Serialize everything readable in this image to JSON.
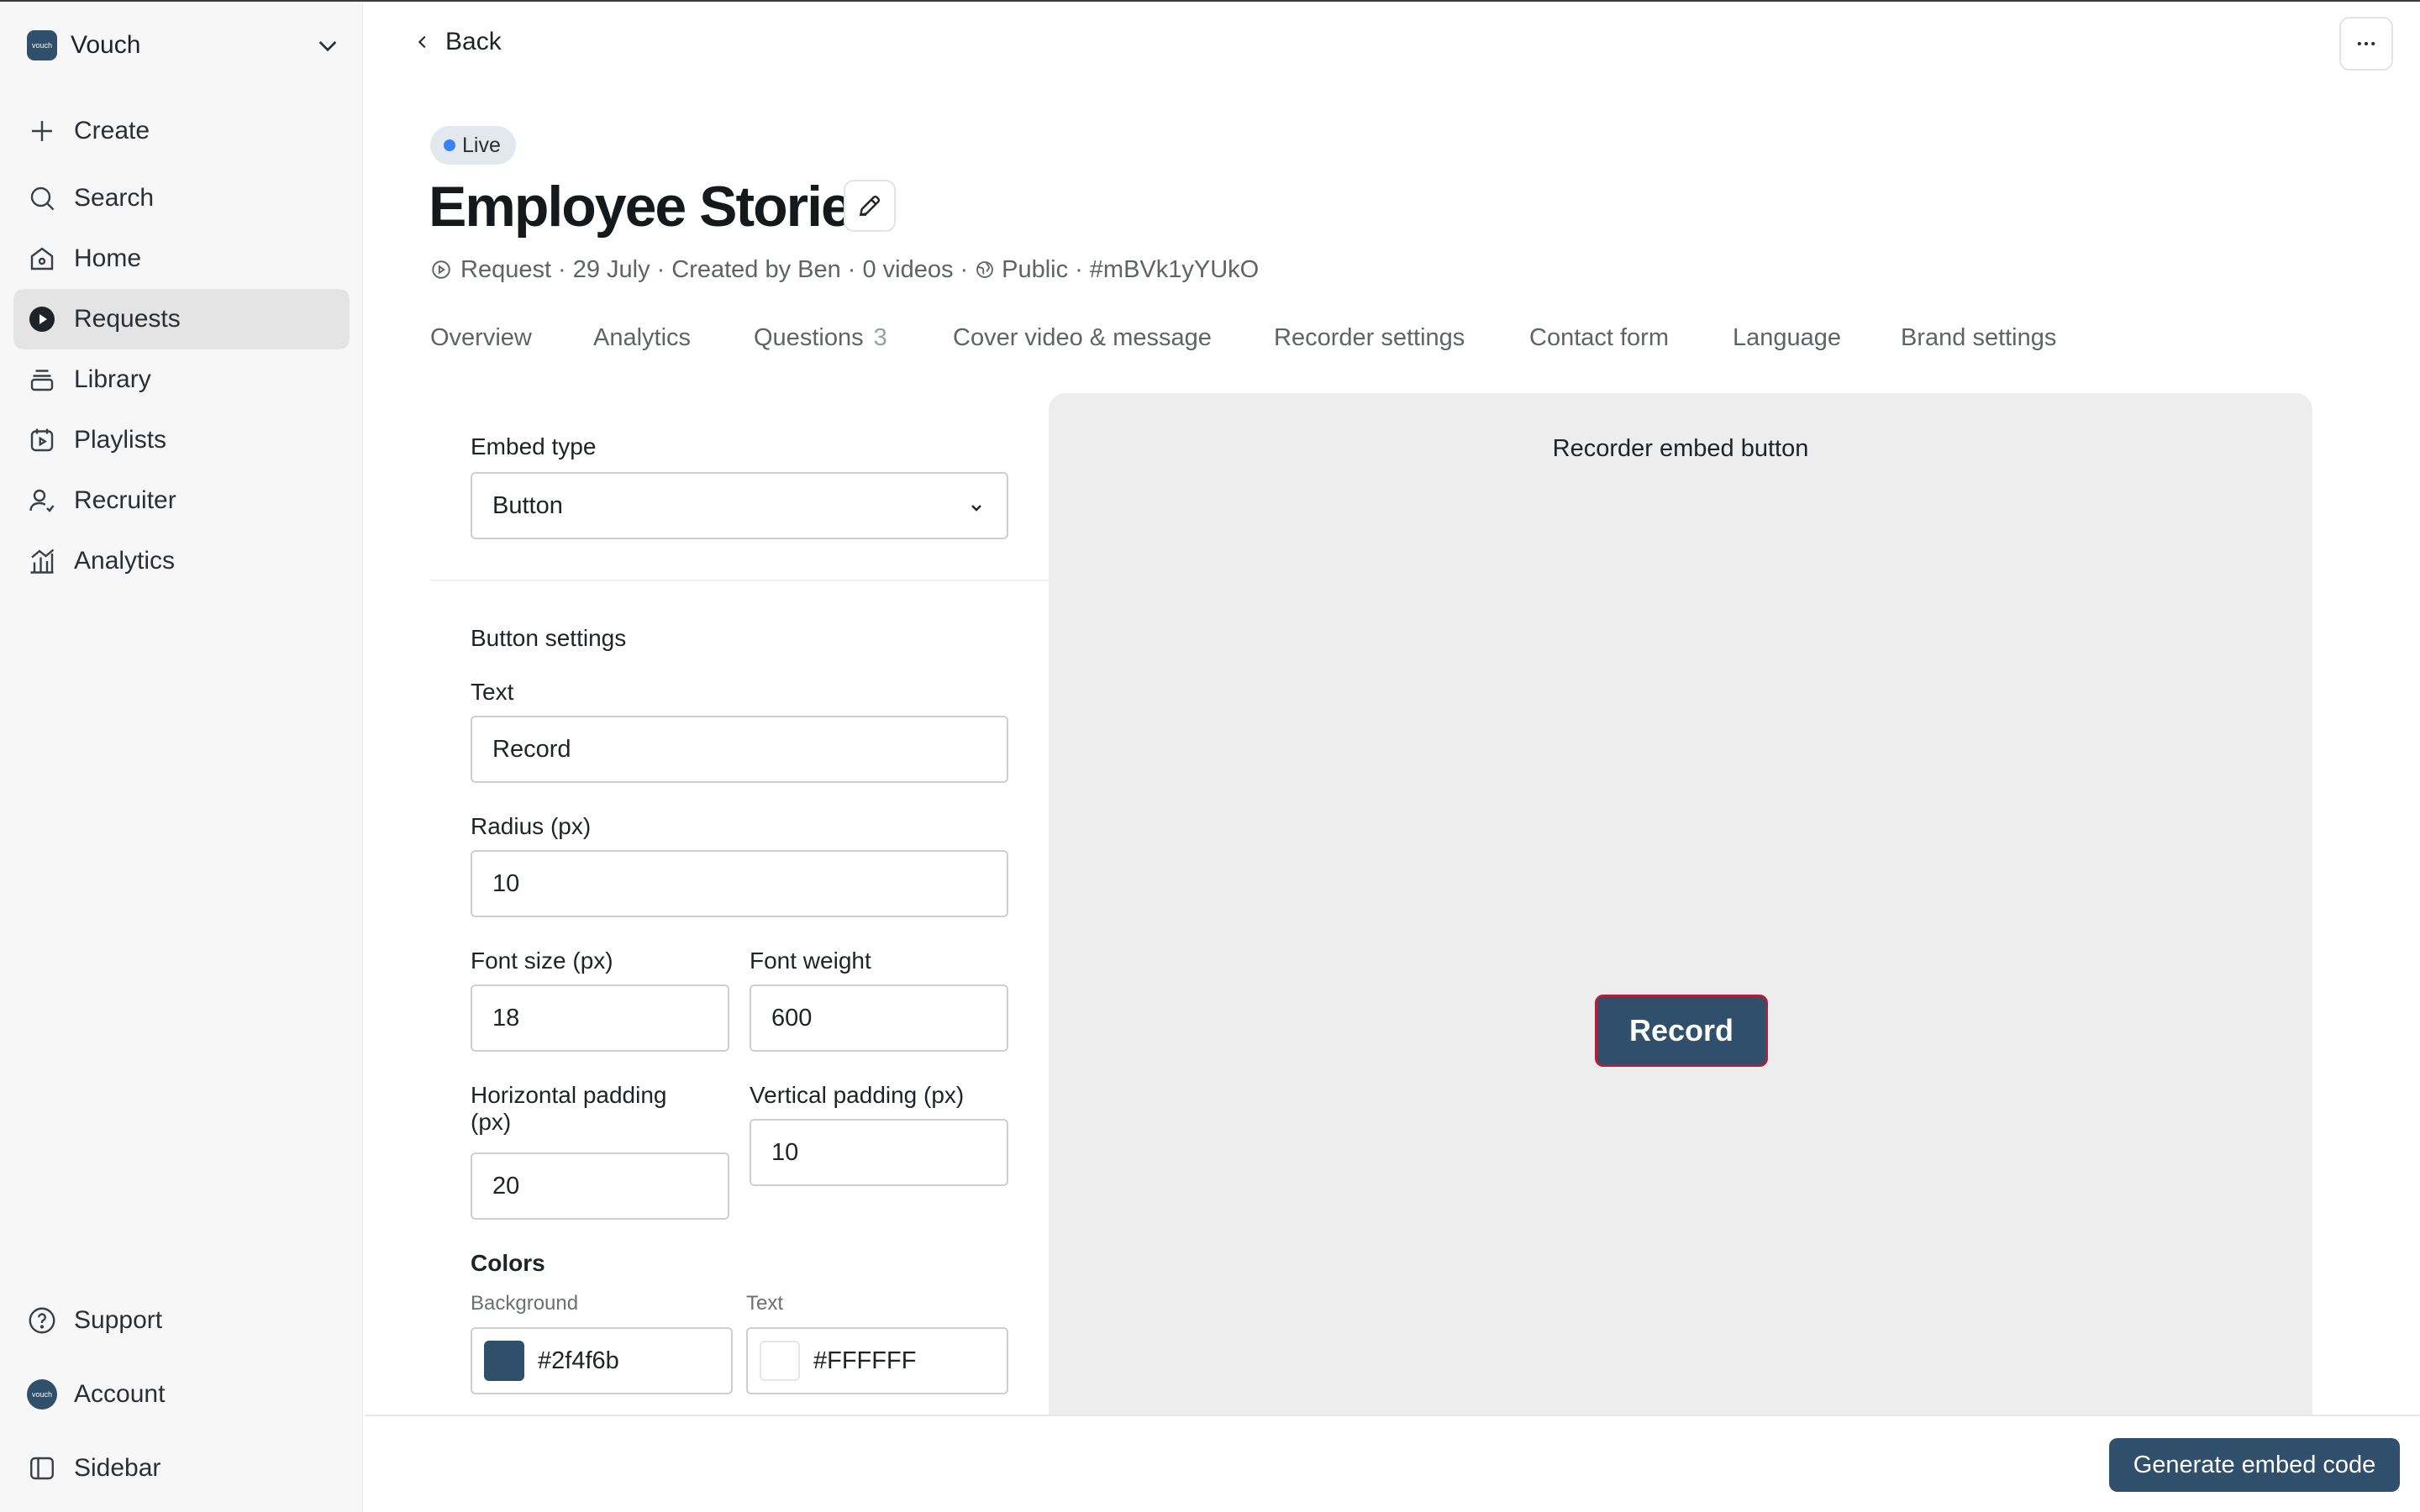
{
  "workspace": {
    "name": "Vouch",
    "logo_text": "vouch"
  },
  "sidebar": {
    "items": [
      {
        "label": "Create",
        "icon": "plus-icon"
      },
      {
        "label": "Search",
        "icon": "search-icon"
      },
      {
        "label": "Home",
        "icon": "home-icon"
      },
      {
        "label": "Requests",
        "icon": "requests-icon",
        "active": true
      },
      {
        "label": "Library",
        "icon": "library-icon"
      },
      {
        "label": "Playlists",
        "icon": "playlists-icon"
      },
      {
        "label": "Recruiter",
        "icon": "recruiter-icon"
      },
      {
        "label": "Analytics",
        "icon": "analytics-icon"
      }
    ],
    "bottom": [
      {
        "label": "Support",
        "icon": "help-icon"
      },
      {
        "label": "Account",
        "icon": "account-avatar"
      },
      {
        "label": "Sidebar",
        "icon": "sidebar-toggle-icon"
      }
    ]
  },
  "header": {
    "back_label": "Back",
    "status": "Live",
    "title": "Employee Stories",
    "meta": {
      "type": "Request",
      "date": "29 July",
      "created_by": "Created by Ben",
      "videos": "0 videos",
      "visibility": "Public",
      "id": "#mBVk1yYUkO"
    }
  },
  "tabs": [
    {
      "label": "Overview"
    },
    {
      "label": "Analytics"
    },
    {
      "label": "Questions",
      "count": "3"
    },
    {
      "label": "Cover video & message"
    },
    {
      "label": "Recorder settings"
    },
    {
      "label": "Contact form"
    },
    {
      "label": "Language"
    },
    {
      "label": "Brand settings"
    }
  ],
  "settings": {
    "embed_type_label": "Embed type",
    "embed_type_value": "Button",
    "button_settings_label": "Button settings",
    "text_label": "Text",
    "text_value": "Record",
    "radius_label": "Radius (px)",
    "radius_value": "10",
    "font_size_label": "Font size (px)",
    "font_size_value": "18",
    "font_weight_label": "Font weight",
    "font_weight_value": "600",
    "h_padding_label_line1": "Horizontal padding",
    "h_padding_label_line2": "(px)",
    "h_padding_value": "20",
    "v_padding_label": "Vertical padding (px)",
    "v_padding_value": "10",
    "colors_label": "Colors",
    "bg_color_label": "Background",
    "bg_color_value": "#2f4f6b",
    "text_color_label": "Text",
    "text_color_value": "#FFFFFF"
  },
  "preview": {
    "title": "Recorder embed button",
    "button_label": "Record"
  },
  "footer": {
    "generate_label": "Generate embed code"
  },
  "colors": {
    "brand": "#2f4f6b",
    "button_border": "#b01f3c",
    "live_dot": "#3b82f6",
    "text_swatch": "#FFFFFF"
  }
}
